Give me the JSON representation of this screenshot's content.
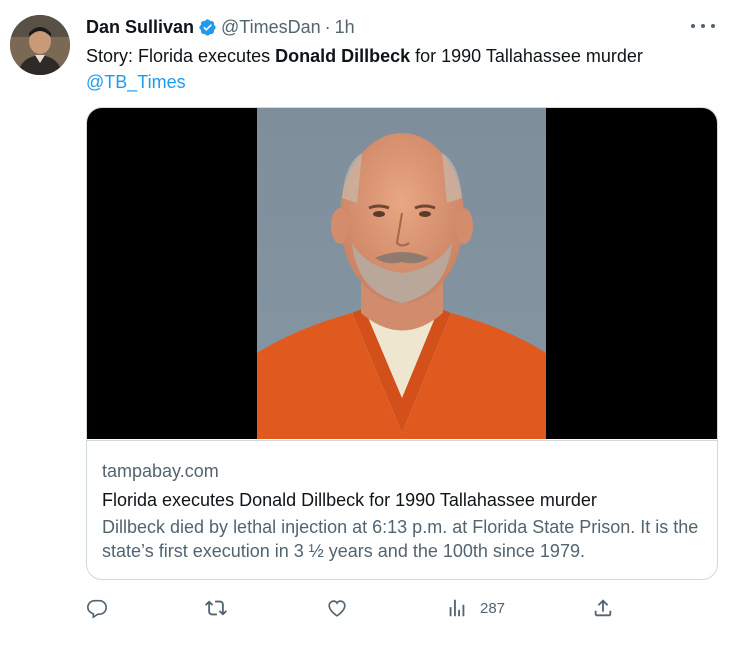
{
  "tweet": {
    "author_name": "Dan Sullivan",
    "handle": "@TimesDan",
    "separator": "·",
    "time": "1h",
    "text_prefix": "Story: Florida executes ",
    "text_bold": "Donald Dillbeck",
    "text_suffix": " for 1990 Tallahassee murder",
    "mention": "@TB_Times"
  },
  "card": {
    "domain": "tampabay.com",
    "title": "Florida executes Donald Dillbeck for 1990 Tallahassee murder",
    "description": "Dillbeck died by lethal injection at 6:13 p.m. at Florida State Prison. It is the state’s first execution in 3 ½ years and the 100th since 1979."
  },
  "actions": {
    "reply_icon": "reply-icon",
    "retweet_icon": "retweet-icon",
    "like_icon": "heart-icon",
    "views_icon": "views-icon",
    "views_count": "287",
    "share_icon": "share-icon"
  },
  "colors": {
    "link": "#1d9bf0",
    "secondary_text": "#536471",
    "verified_badge": "#1d9bf0",
    "border": "#cfd9de"
  }
}
